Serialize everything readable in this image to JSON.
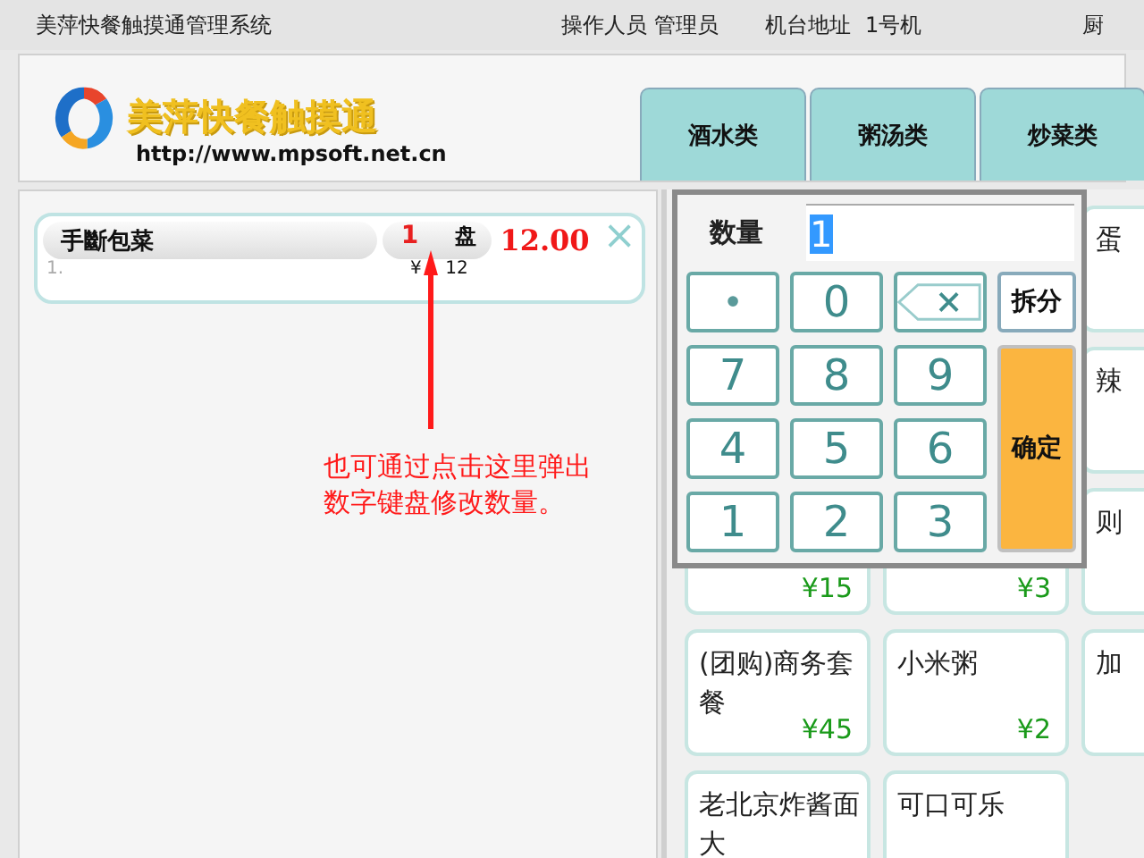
{
  "title_bar": {
    "app_name": "美萍快餐触摸通管理系统",
    "operator_label": "操作人员",
    "operator": "管理员",
    "terminal_label": "机台地址",
    "terminal": "1号机",
    "cut_text": "厨"
  },
  "logo": {
    "name": "美萍快餐触摸通",
    "url": "http://www.mpsoft.net.cn"
  },
  "categories": [
    {
      "label": "酒水类"
    },
    {
      "label": "粥汤类"
    },
    {
      "label": "炒菜类"
    }
  ],
  "order_items": [
    {
      "index": "1.",
      "name": "手斷包菜",
      "quantity": "1",
      "unit": "盘",
      "amount": "12.00",
      "price": "¥ 12"
    }
  ],
  "annotation": {
    "text": "也可通过点击这里弹出数字键盘修改数量。"
  },
  "keypad": {
    "label": "数量",
    "value": "1",
    "keys": [
      {
        "kind": "dot",
        "label": "•"
      },
      {
        "kind": "digit",
        "label": "0"
      },
      {
        "kind": "backspace"
      },
      {
        "kind": "action",
        "label": "拆分"
      },
      {
        "kind": "digit",
        "label": "7"
      },
      {
        "kind": "digit",
        "label": "8"
      },
      {
        "kind": "digit",
        "label": "9"
      },
      {
        "kind": "digit",
        "label": "4"
      },
      {
        "kind": "digit",
        "label": "5"
      },
      {
        "kind": "digit",
        "label": "6"
      },
      {
        "kind": "confirm",
        "label": "确定"
      },
      {
        "kind": "digit",
        "label": "1"
      },
      {
        "kind": "digit",
        "label": "2"
      },
      {
        "kind": "digit",
        "label": "3"
      }
    ]
  },
  "dish_rows": [
    [
      null,
      null,
      {
        "name": "蛋"
      }
    ],
    [
      null,
      null,
      {
        "name": "辣"
      }
    ],
    [
      {
        "price": "¥15"
      },
      {
        "price": "¥3"
      },
      {
        "name": "则"
      }
    ],
    [
      {
        "name": "(团购)商务套餐",
        "price": "¥45"
      },
      {
        "name": "小米粥",
        "price": "¥2"
      },
      {
        "name": "加"
      }
    ],
    [
      {
        "name": "老北京炸酱面大"
      },
      {
        "name": "可口可乐"
      },
      null
    ]
  ]
}
